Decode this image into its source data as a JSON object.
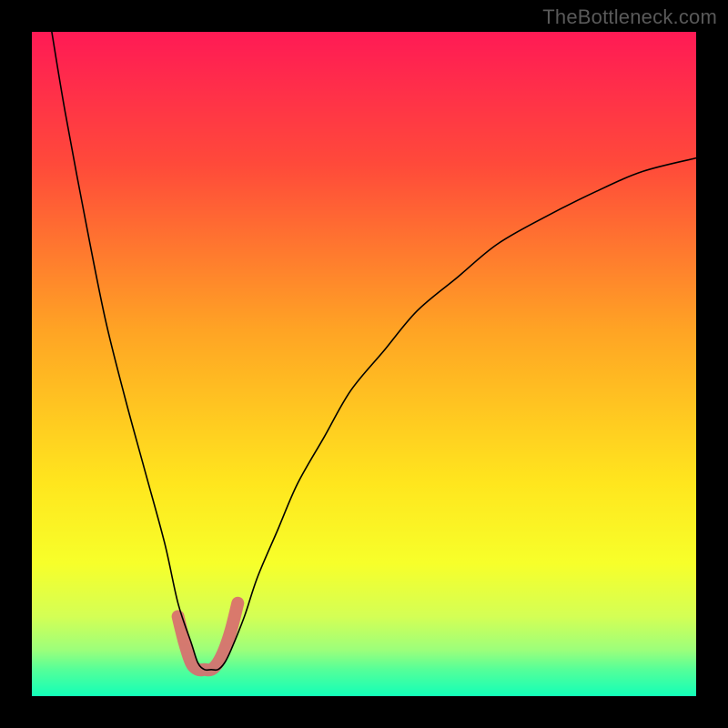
{
  "watermark": "TheBottleneck.com",
  "chart_data": {
    "type": "line",
    "title": "",
    "xlabel": "",
    "ylabel": "",
    "xlim": [
      0,
      100
    ],
    "ylim": [
      0,
      100
    ],
    "grid": false,
    "series": [
      {
        "name": "bottleneck-curve",
        "x": [
          3,
          5,
          8,
          11,
          14,
          17,
          20,
          22,
          24,
          25,
          26,
          27,
          28,
          29,
          30,
          32,
          34,
          37,
          40,
          44,
          48,
          53,
          58,
          64,
          70,
          77,
          85,
          92,
          100
        ],
        "y": [
          100,
          88,
          72,
          57,
          45,
          34,
          23,
          14,
          8,
          5,
          4,
          4,
          4,
          5,
          7,
          12,
          18,
          25,
          32,
          39,
          46,
          52,
          58,
          63,
          68,
          72,
          76,
          79,
          81
        ]
      },
      {
        "name": "highlight-bottom",
        "x": [
          22,
          23,
          24,
          25,
          26,
          27,
          28,
          29,
          30,
          31
        ],
        "y": [
          12,
          8,
          5,
          4,
          4,
          4,
          5,
          7,
          10,
          14
        ]
      }
    ],
    "gradient_stops": [
      {
        "pct": 0,
        "color": "#ff1a55"
      },
      {
        "pct": 20,
        "color": "#ff4a3a"
      },
      {
        "pct": 45,
        "color": "#ffa424"
      },
      {
        "pct": 68,
        "color": "#ffe61e"
      },
      {
        "pct": 80,
        "color": "#f7ff2a"
      },
      {
        "pct": 88,
        "color": "#d4ff55"
      },
      {
        "pct": 93,
        "color": "#9dff7a"
      },
      {
        "pct": 96,
        "color": "#55ff99"
      },
      {
        "pct": 100,
        "color": "#12ffb8"
      }
    ],
    "highlight_style": {
      "stroke": "#d96a6f",
      "width": 14,
      "opacity": 0.9,
      "cap": "round"
    },
    "curve_style": {
      "stroke": "#000000",
      "width": 1.6
    }
  }
}
